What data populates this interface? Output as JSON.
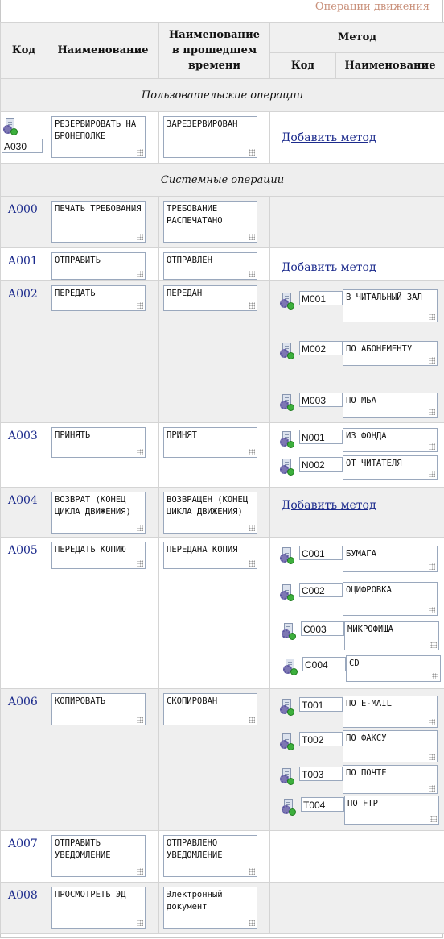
{
  "page": {
    "title": "Операции движения"
  },
  "header": {
    "code": "Код",
    "name": "Наименование",
    "past": "Наименование в прошедшем времени",
    "method": "Метод",
    "method_code": "Код",
    "method_name": "Наименование"
  },
  "sections": {
    "user": "Пользовательские операции",
    "system": "Системные операции"
  },
  "add_method": "Добавить метод",
  "user_op": {
    "code": "A030",
    "name": "РЕЗЕРВИРОВАТЬ НА БРОНЕПОЛКЕ",
    "past": "ЗАРЕЗЕРВИРОВАН"
  },
  "ops": [
    {
      "code": "A000",
      "name": "ПЕЧАТЬ ТРЕБОВАНИЯ",
      "past": "ТРЕБОВАНИЕ РАСПЕЧАТАНО"
    },
    {
      "code": "A001",
      "name": "ОТПРАВИТЬ",
      "past": "ОТПРАВЛЕН"
    },
    {
      "code": "A002",
      "name": "ПЕРЕДАТЬ",
      "past": "ПЕРЕДАН",
      "methods": [
        {
          "code": "M001",
          "name": "В ЧИТАЛЬНЫЙ ЗАЛ"
        },
        {
          "code": "M002",
          "name": "ПО АБОНЕМЕНТУ"
        },
        {
          "code": "M003",
          "name": "ПО МБА"
        }
      ]
    },
    {
      "code": "A003",
      "name": "ПРИНЯТЬ",
      "past": "ПРИНЯТ",
      "methods": [
        {
          "code": "N001",
          "name": "ИЗ ФОНДА"
        },
        {
          "code": "N002",
          "name": "ОТ ЧИТАТЕЛЯ"
        }
      ]
    },
    {
      "code": "A004",
      "name": "ВОЗВРАТ (КОНЕЦ ЦИКЛА ДВИЖЕНИЯ)",
      "past": "ВОЗВРАЩЕН (КОНЕЦ ЦИКЛА ДВИЖЕНИЯ)"
    },
    {
      "code": "A005",
      "name": "ПЕРЕДАТЬ КОПИЮ",
      "past": "ПЕРЕДАНА КОПИЯ",
      "methods": [
        {
          "code": "C001",
          "name": "БУМАГА"
        },
        {
          "code": "C002",
          "name": "ОЦИФРОВКА"
        },
        {
          "code": "C003",
          "name": "МИКРОФИША"
        },
        {
          "code": "C004",
          "name": "CD"
        }
      ]
    },
    {
      "code": "A006",
      "name": "КОПИРОВАТЬ",
      "past": "СКОПИРОВАН",
      "methods": [
        {
          "code": "T001",
          "name": "ПО E-MAIL"
        },
        {
          "code": "T002",
          "name": "ПО ФАКСУ"
        },
        {
          "code": "T003",
          "name": "ПО ПОЧТЕ"
        },
        {
          "code": "T004",
          "name": "ПО FTP"
        }
      ]
    },
    {
      "code": "A007",
      "name": "ОТПРАВИТЬ УВЕДОМЛЕНИЕ",
      "past": "ОТПРАВЛЕНО УВЕДОМЛЕНИЕ"
    },
    {
      "code": "A008",
      "name": "ПРОСМОТРЕТЬ ЭД",
      "past": "Электронный документ"
    }
  ]
}
